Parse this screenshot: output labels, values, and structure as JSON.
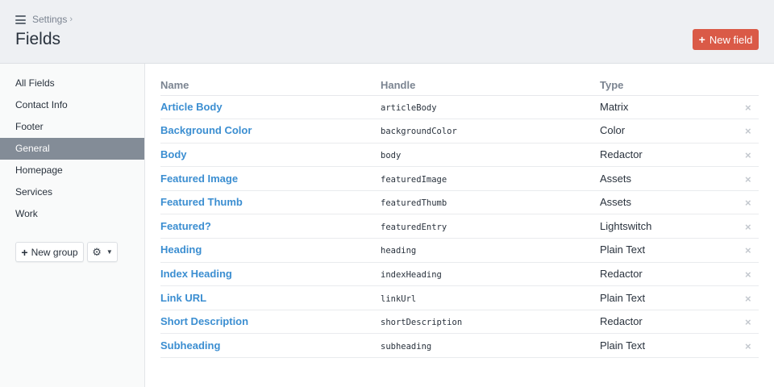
{
  "header": {
    "breadcrumb": "Settings",
    "breadcrumb_sep": "›",
    "title": "Fields",
    "new_field_label": "New field",
    "new_field_icon": "+"
  },
  "sidebar": {
    "items": [
      {
        "label": "All Fields"
      },
      {
        "label": "Contact Info"
      },
      {
        "label": "Footer"
      },
      {
        "label": "General",
        "active": true
      },
      {
        "label": "Homepage"
      },
      {
        "label": "Services"
      },
      {
        "label": "Work"
      }
    ],
    "new_group_label": "New group",
    "new_group_icon": "+",
    "gear_icon": "⚙",
    "chevron_icon": "⌄"
  },
  "table": {
    "columns": {
      "name": "Name",
      "handle": "Handle",
      "type": "Type"
    },
    "delete_icon": "×",
    "rows": [
      {
        "name": "Article Body",
        "handle": "articleBody",
        "type": "Matrix"
      },
      {
        "name": "Background Color",
        "handle": "backgroundColor",
        "type": "Color"
      },
      {
        "name": "Body",
        "handle": "body",
        "type": "Redactor"
      },
      {
        "name": "Featured Image",
        "handle": "featuredImage",
        "type": "Assets"
      },
      {
        "name": "Featured Thumb",
        "handle": "featuredThumb",
        "type": "Assets"
      },
      {
        "name": "Featured?",
        "handle": "featuredEntry",
        "type": "Lightswitch"
      },
      {
        "name": "Heading",
        "handle": "heading",
        "type": "Plain Text"
      },
      {
        "name": "Index Heading",
        "handle": "indexHeading",
        "type": "Redactor"
      },
      {
        "name": "Link URL",
        "handle": "linkUrl",
        "type": "Plain Text"
      },
      {
        "name": "Short Description",
        "handle": "shortDescription",
        "type": "Redactor"
      },
      {
        "name": "Subheading",
        "handle": "subheading",
        "type": "Plain Text"
      }
    ]
  },
  "colors": {
    "accent": "#da5a47",
    "link": "#3b8ed1",
    "active_nav": "#838c97"
  }
}
